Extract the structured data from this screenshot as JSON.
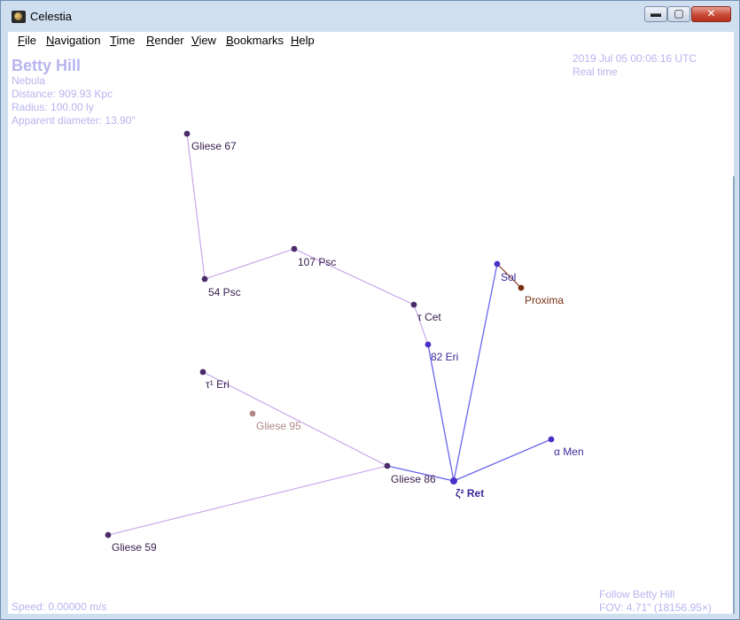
{
  "window": {
    "title": "Celestia"
  },
  "controls": {
    "minimize": "▬",
    "maximize": "▢",
    "close": "✕"
  },
  "menu": [
    {
      "key": "file",
      "label": "File",
      "ul": "F",
      "rest": "ile"
    },
    {
      "key": "navigation",
      "label": "Navigation",
      "ul": "N",
      "rest": "avigation"
    },
    {
      "key": "time",
      "label": "Time",
      "ul": "T",
      "rest": "ime"
    },
    {
      "key": "render",
      "label": "Render",
      "ul": "R",
      "rest": "ender"
    },
    {
      "key": "view",
      "label": "View",
      "ul": "V",
      "rest": "iew"
    },
    {
      "key": "bookmarks",
      "label": "Bookmarks",
      "ul": "B",
      "rest": "ookmarks"
    },
    {
      "key": "help",
      "label": "Help",
      "ul": "H",
      "rest": "elp"
    }
  ],
  "selection": {
    "name": "Betty Hill",
    "type": "Nebula",
    "distance": "Distance: 909.93 Kpc",
    "radius": "Radius: 100.00 ly",
    "apparent_diameter": "Apparent diameter: 13.90\""
  },
  "time": {
    "datetime": "2019 Jul 05 00:06:16 UTC",
    "mode": "Real time"
  },
  "status": {
    "speed": "Speed: 0.00000 m/s",
    "follow": "Follow Betty Hill",
    "fov": "FOV: 4.71\" (18156.95×)"
  },
  "colors": {
    "hud_text": "#b8b4ee",
    "line_violet": "#c4a2ea",
    "line_blue": "#6a64ea",
    "star_dark": "#4a2a68",
    "star_blue": "#4a30c8",
    "label_dark": "#3a2050",
    "label_blue": "#3a2a9a",
    "proxima": "#7a3010",
    "gliese95": "#b08888"
  },
  "stars": [
    {
      "id": "gliese-67",
      "label": "Gliese 67"
    },
    {
      "id": "54-psc",
      "label": "54 Psc"
    },
    {
      "id": "107-psc",
      "label": "107 Psc"
    },
    {
      "id": "tau-cet",
      "label": "τ Cet"
    },
    {
      "id": "82-eri",
      "label": "82 Eri"
    },
    {
      "id": "sol",
      "label": "Sol"
    },
    {
      "id": "proxima",
      "label": "Proxima"
    },
    {
      "id": "tau1-eri",
      "label": "τ¹ Eri"
    },
    {
      "id": "gliese-95",
      "label": "Gliese 95"
    },
    {
      "id": "gliese-86",
      "label": "Gliese 86"
    },
    {
      "id": "zeta2-ret",
      "label": "ζ² Ret"
    },
    {
      "id": "alpha-men",
      "label": "α Men"
    },
    {
      "id": "gliese-59",
      "label": "Gliese 59"
    }
  ]
}
